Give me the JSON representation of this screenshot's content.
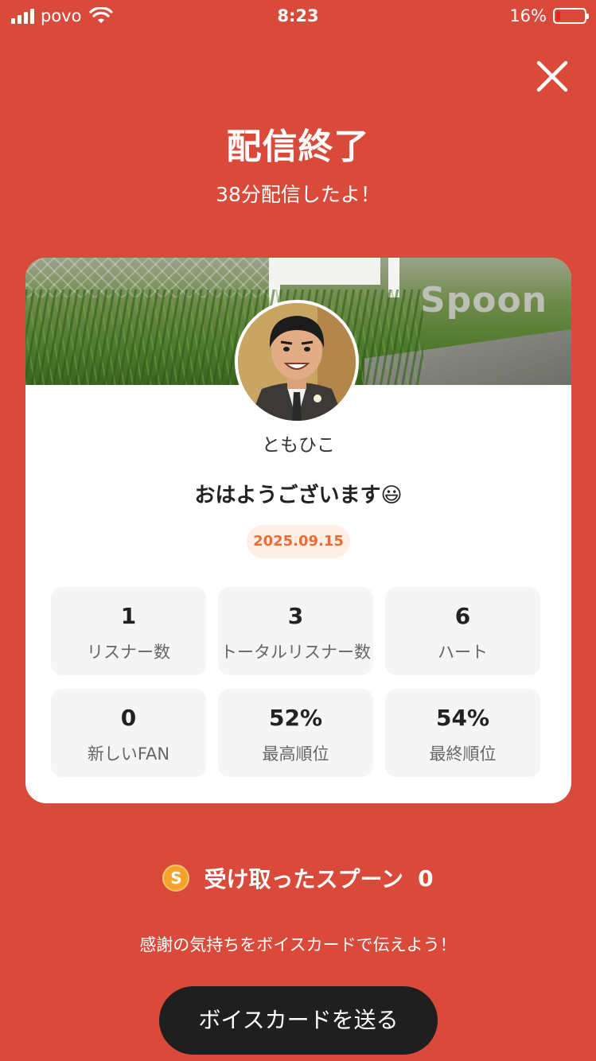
{
  "status_bar": {
    "carrier": "povo",
    "time": "8:23",
    "battery_percent": "16%",
    "battery_level": 0.16
  },
  "header": {
    "close_icon": "close-icon",
    "title": "配信終了",
    "subtitle": "38分配信したよ！"
  },
  "card": {
    "watermark": "Spoon",
    "username": "ともひこ",
    "status_message": "おはようございます😃",
    "date": "2025.09.15",
    "stats": [
      {
        "value": "1",
        "label": "リスナー数"
      },
      {
        "value": "3",
        "label": "トータルリスナー数"
      },
      {
        "value": "6",
        "label": "ハート"
      },
      {
        "value": "0",
        "label": "新しいFAN"
      },
      {
        "value": "52%",
        "label": "最高順位"
      },
      {
        "value": "54%",
        "label": "最終順位"
      }
    ]
  },
  "spoons": {
    "icon": "spoon-coin-icon",
    "coin_letter": "S",
    "label": "受け取ったスプーン",
    "count": "0"
  },
  "footer": {
    "thanks": "感謝の気持ちをボイスカードで伝えよう！",
    "cta_label": "ボイスカードを送る"
  },
  "colors": {
    "background": "#d94a3a",
    "button": "#1f1f1f",
    "date_badge_bg": "#fdeee6",
    "date_badge_text": "#f06a35"
  }
}
